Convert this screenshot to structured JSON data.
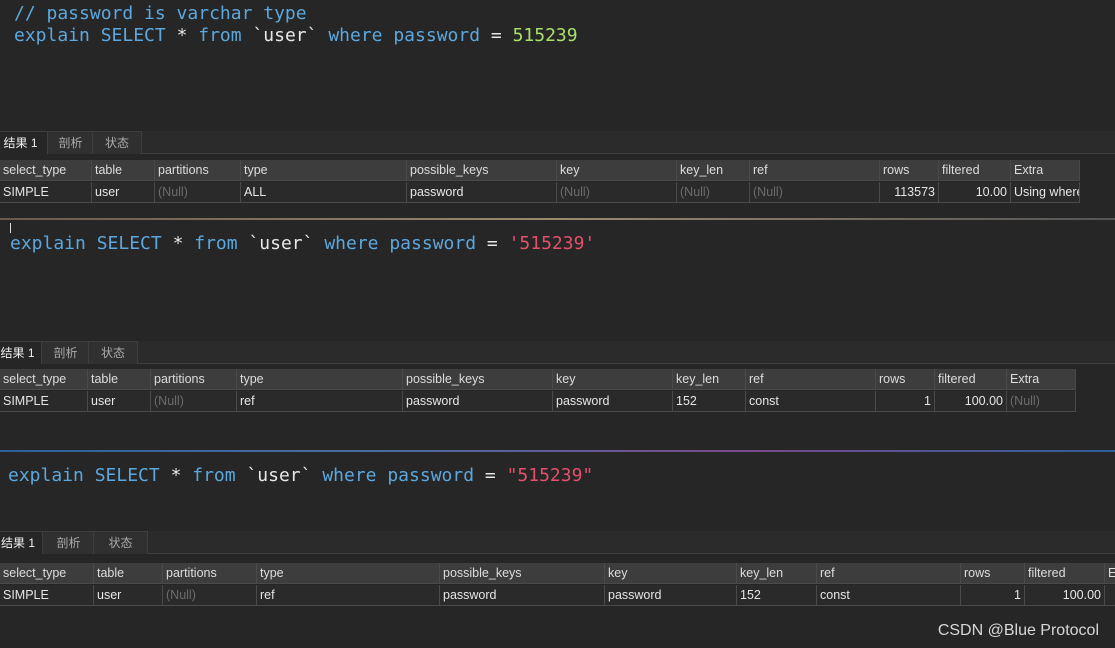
{
  "queries": [
    {
      "comment": "// password is varchar type",
      "parts": [
        [
          "kw",
          "explain SELECT"
        ],
        [
          "",
          "*"
        ],
        [
          "kw",
          "from"
        ],
        [
          "",
          "`user`"
        ],
        [
          "kw",
          "where password"
        ],
        [
          "",
          "="
        ],
        [
          "num",
          "515239"
        ]
      ]
    },
    {
      "parts": [
        [
          "kw",
          "explain SELECT"
        ],
        [
          "",
          "*"
        ],
        [
          "kw",
          "from"
        ],
        [
          "",
          "`user`"
        ],
        [
          "kw",
          "where password"
        ],
        [
          "",
          "="
        ],
        [
          "str",
          "'515239'"
        ]
      ]
    },
    {
      "parts": [
        [
          "kw",
          "explain SELECT"
        ],
        [
          "",
          "*"
        ],
        [
          "kw",
          "from"
        ],
        [
          "",
          "`user`"
        ],
        [
          "kw",
          "where password"
        ],
        [
          "",
          "="
        ],
        [
          "str",
          "\"515239\""
        ]
      ]
    }
  ],
  "tabs": [
    "结果 1",
    "剖析",
    "状态"
  ],
  "columns": [
    "select_type",
    "table",
    "partitions",
    "type",
    "possible_keys",
    "key",
    "key_len",
    "ref",
    "rows",
    "filtered",
    "Extra"
  ],
  "results": [
    [
      "SIMPLE",
      "user",
      "(Null)",
      "ALL",
      "password",
      "(Null)",
      "(Null)",
      "(Null)",
      "113573",
      "10.00",
      "Using where"
    ],
    [
      "SIMPLE",
      "user",
      "(Null)",
      "ref",
      "password",
      "password",
      "152",
      "const",
      "1",
      "100.00",
      "(Null)"
    ],
    [
      "SIMPLE",
      "user",
      "(Null)",
      "ref",
      "password",
      "password",
      "152",
      "const",
      "1",
      "100.00",
      ""
    ]
  ],
  "watermark": "CSDN @Blue Protocol",
  "colors": {
    "keyword": "#5ca8de",
    "number": "#a8e06a",
    "string": "#e4506a",
    "background": "#262626"
  }
}
